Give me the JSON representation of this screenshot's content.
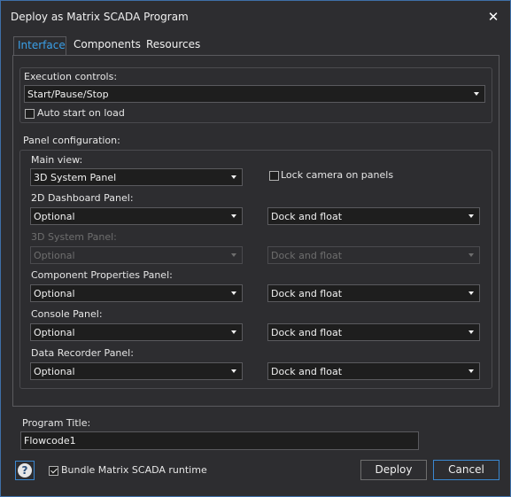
{
  "window": {
    "title": "Deploy as Matrix SCADA Program",
    "close_label": "✕"
  },
  "tabs": [
    {
      "label": "Interface",
      "active": true
    },
    {
      "label": "Components",
      "active": false
    },
    {
      "label": "Resources",
      "active": false
    }
  ],
  "execution": {
    "group_label": "Execution controls:",
    "selected": "Start/Pause/Stop",
    "auto_start_label": "Auto start on load",
    "auto_start_checked": false
  },
  "panel_config": {
    "group_label": "Panel configuration:",
    "main_view_label": "Main view:",
    "main_view_value": "3D System Panel",
    "lock_camera_label": "Lock camera on panels",
    "lock_camera_checked": false,
    "panels": [
      {
        "label": "2D Dashboard Panel:",
        "visibility": "Optional",
        "docking": "Dock and float",
        "enabled": true
      },
      {
        "label": "3D System Panel:",
        "visibility": "Optional",
        "docking": "Dock and float",
        "enabled": false
      },
      {
        "label": "Component Properties Panel:",
        "visibility": "Optional",
        "docking": "Dock and float",
        "enabled": true
      },
      {
        "label": "Console Panel:",
        "visibility": "Optional",
        "docking": "Dock and float",
        "enabled": true
      },
      {
        "label": "Data Recorder Panel:",
        "visibility": "Optional",
        "docking": "Dock and float",
        "enabled": true
      }
    ]
  },
  "program_title": {
    "label": "Program Title:",
    "value": "Flowcode1"
  },
  "footer": {
    "help_glyph": "?",
    "bundle_label": "Bundle Matrix SCADA runtime",
    "bundle_checked": true,
    "deploy_label": "Deploy",
    "cancel_label": "Cancel"
  },
  "icons": {
    "help": "help-icon",
    "close": "close-icon",
    "dropdown": "chevron-down-icon"
  },
  "colors": {
    "accent": "#3aa0e8",
    "background": "#2d2d30",
    "field": "#1e1e1e",
    "focus_border": "#3a87d0"
  }
}
